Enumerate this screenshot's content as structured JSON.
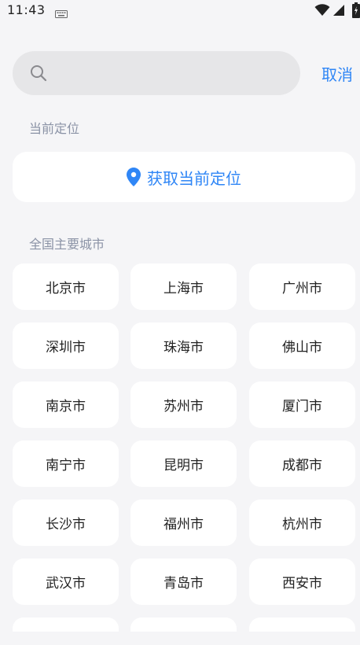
{
  "status_bar": {
    "time": "11:43",
    "icons": [
      "keyboard-icon",
      "wifi-icon",
      "signal-icon",
      "battery-icon"
    ]
  },
  "search": {
    "value": "",
    "placeholder": "",
    "cancel_label": "取消"
  },
  "current_location": {
    "section_title": "当前定位",
    "button_label": "获取当前定位",
    "icon": "location-pin-icon"
  },
  "cities": {
    "section_title": "全国主要城市",
    "items": [
      "北京市",
      "上海市",
      "广州市",
      "深圳市",
      "珠海市",
      "佛山市",
      "南京市",
      "苏州市",
      "厦门市",
      "南宁市",
      "昆明市",
      "成都市",
      "长沙市",
      "福州市",
      "杭州市",
      "武汉市",
      "青岛市",
      "西安市",
      "",
      "",
      ""
    ]
  },
  "colors": {
    "background": "#f5f5f7",
    "accent": "#2f86f6",
    "card": "#ffffff",
    "search_bg": "#e6e6e8",
    "section_text": "#8b93a6"
  }
}
